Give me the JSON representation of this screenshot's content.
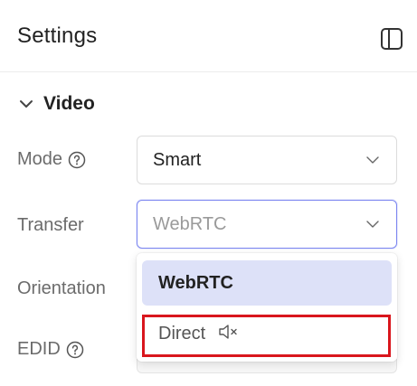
{
  "header": {
    "title": "Settings",
    "panel_icon": "sidebar-toggle-icon"
  },
  "section": {
    "label": "Video",
    "icon": "chevron-down-icon"
  },
  "fields": {
    "mode": {
      "label": "Mode",
      "value": "Smart"
    },
    "transfer": {
      "label": "Transfer",
      "value": "WebRTC"
    },
    "orientation": {
      "label": "Orientation"
    },
    "edid": {
      "label": "EDID"
    }
  },
  "dropdown": {
    "options": [
      {
        "label": "WebRTC",
        "selected": true
      },
      {
        "label": "Direct",
        "icon": "speaker-muted-icon"
      }
    ]
  },
  "colors": {
    "accent": "#7c86f0",
    "selected_bg": "#dde1f8",
    "highlight": "#d9161d",
    "label": "#6b6b6b"
  }
}
